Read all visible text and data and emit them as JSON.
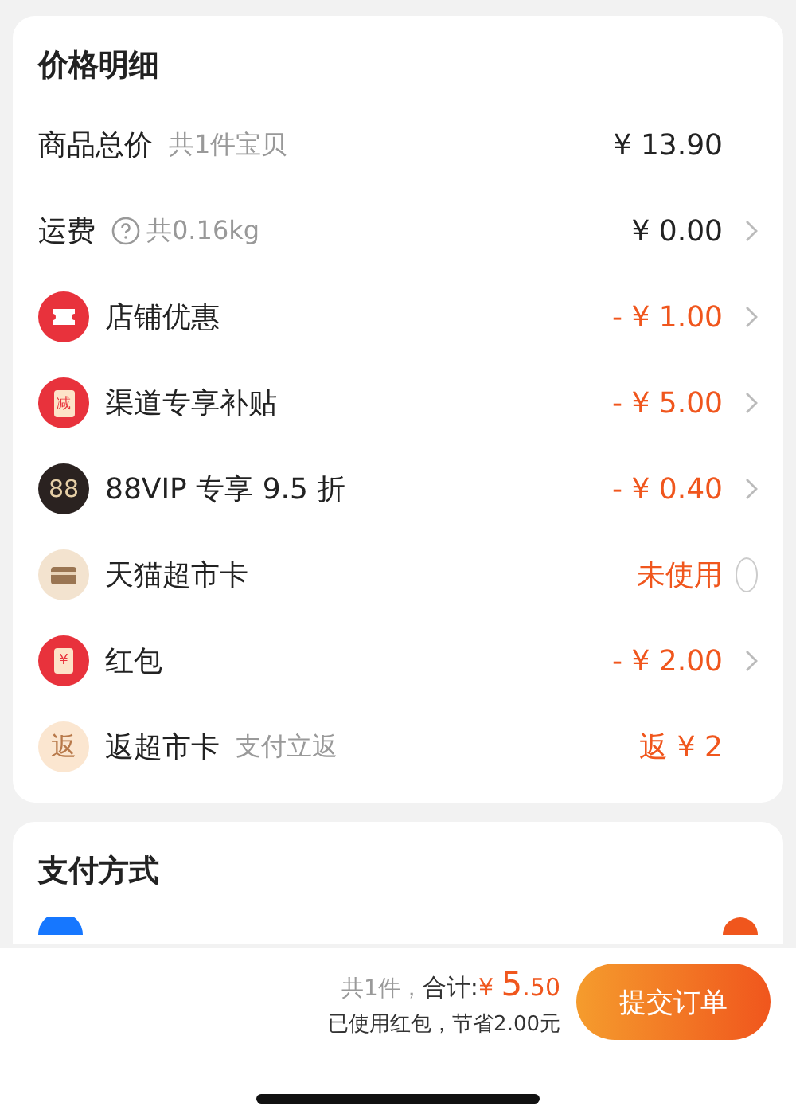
{
  "price_detail": {
    "title": "价格明细",
    "rows": [
      {
        "kind": "plain",
        "label": "商品总价",
        "note": "共1件宝贝",
        "amount": "¥ 13.90",
        "discount": false,
        "arrow": false
      },
      {
        "kind": "plain",
        "label": "运费",
        "note": "共0.16kg",
        "help": true,
        "amount": "¥ 0.00",
        "discount": false,
        "arrow": true
      },
      {
        "kind": "ticket",
        "label": "店铺优惠",
        "amount": "- ¥ 1.00",
        "discount": true,
        "arrow": true
      },
      {
        "kind": "reduce",
        "glyph": "减",
        "label": "渠道专享补贴",
        "amount": "- ¥ 5.00",
        "discount": true,
        "arrow": true
      },
      {
        "kind": "vip",
        "glyph": "88",
        "label": "88VIP 专享 9.5 折",
        "amount": "- ¥ 0.40",
        "discount": true,
        "arrow": true
      },
      {
        "kind": "card",
        "label": "天猫超市卡",
        "amount": "未使用",
        "discount": true,
        "arrow": false,
        "checked": false
      },
      {
        "kind": "packet",
        "glyph": "¥",
        "label": "红包",
        "amount": "- ¥ 2.00",
        "discount": true,
        "arrow": true
      },
      {
        "kind": "rebate",
        "glyph": "返",
        "label": "返超市卡",
        "note": "支付立返",
        "amount": "返 ¥ 2",
        "discount": true,
        "arrow": false
      }
    ]
  },
  "payment": {
    "title": "支付方式",
    "selected": true
  },
  "footer": {
    "count": "共1件，",
    "total_label": "合计:",
    "currency": "¥",
    "total_int": "5",
    "total_dec": ".50",
    "saving": "已使用红包，节省2.00元",
    "submit": "提交订单"
  }
}
